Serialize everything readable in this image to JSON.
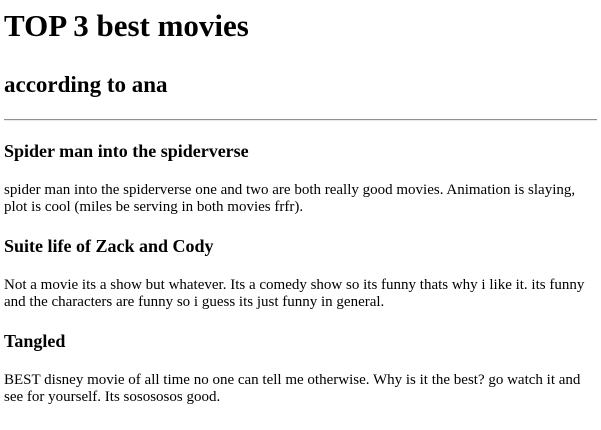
{
  "page": {
    "title": "TOP 3 best movies",
    "subtitle": "according to ana"
  },
  "movies": [
    {
      "title": "Spider man into the spiderverse",
      "description": "spider man into the spiderverse one and two are both really good movies. Animation is slaying, plot is cool (miles be serving in both movies frfr)."
    },
    {
      "title": "Suite life of Zack and Cody",
      "description": "Not a movie its a show but whatever. Its a comedy show so its funny thats why i like it. its funny and the characters are funny so i guess its just funny in general."
    },
    {
      "title": "Tangled",
      "description": "BEST disney movie of all time no one can tell me otherwise. Why is it the best? go watch it and see for yourself. Its sosososos good."
    }
  ]
}
